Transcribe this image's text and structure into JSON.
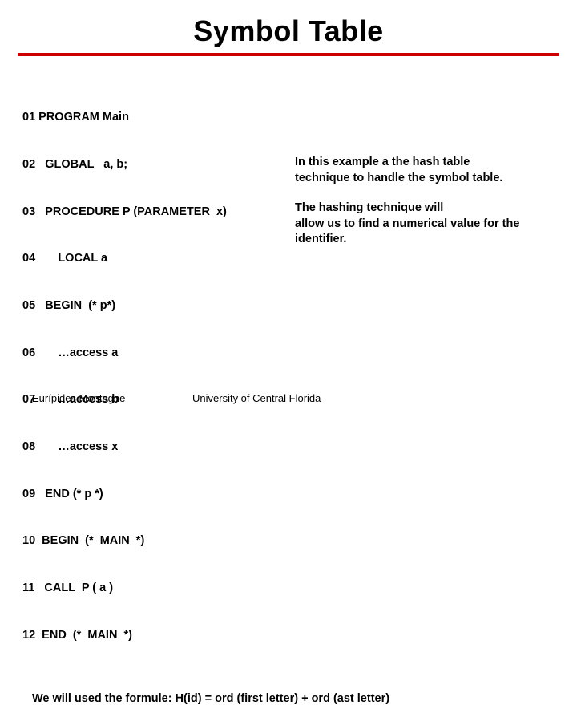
{
  "title": "Symbol Table",
  "code": {
    "l01": "01 PROGRAM Main",
    "l02": "02   GLOBAL   a, b;",
    "l03": "03   PROCEDURE P (PARAMETER  x)",
    "l04": "04       LOCAL a",
    "l05": "05   BEGIN  (* p*)",
    "l06": "06       …access a",
    "l07": "07       …access b",
    "l08": "08       …access x",
    "l09": "09   END (* p *)",
    "l10": "10  BEGIN  (*  MAIN  *)",
    "l11": "11   CALL  P ( a )",
    "l12": "12  END  (*  MAIN  *)"
  },
  "explain": {
    "p1a": "In  this example a   the hash table",
    "p1b": "technique to handle the symbol table.",
    "p2a": "The hashing technique will",
    "p2b": "allow us to find a numerical value for the",
    "p2c": "identifier."
  },
  "formula": "We will used the formule: H(id) = ord (first letter) + ord (ast letter)",
  "footer": {
    "author": "Eurípides Montagne",
    "affiliation": "University of Central Florida"
  }
}
